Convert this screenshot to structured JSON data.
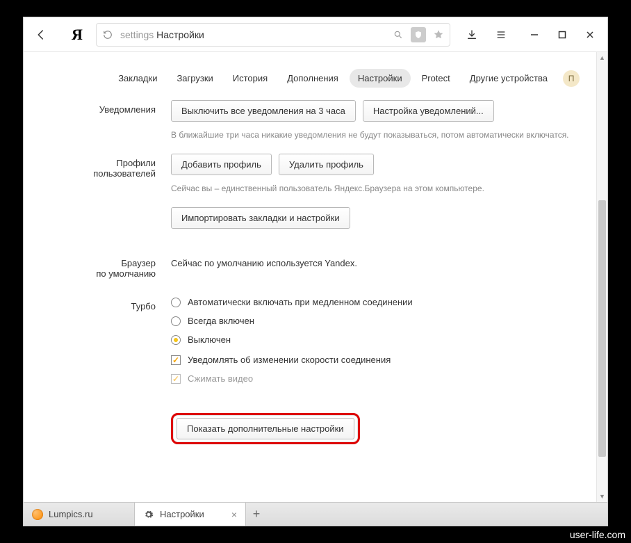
{
  "toolbar": {
    "address_prefix": "settings",
    "address_title": "Настройки"
  },
  "tabs": {
    "items": [
      "Закладки",
      "Загрузки",
      "История",
      "Дополнения",
      "Настройки",
      "Protect",
      "Другие устройства"
    ],
    "active_index": 4,
    "profile_initial": "П"
  },
  "notifications": {
    "label": "Уведомления",
    "btn_disable": "Выключить все уведомления на 3 часа",
    "btn_settings": "Настройка уведомлений...",
    "hint": "В ближайшие три часа никакие уведомления не будут показываться, потом автоматически включатся."
  },
  "profiles": {
    "label_line1": "Профили",
    "label_line2": "пользователей",
    "btn_add": "Добавить профиль",
    "btn_delete": "Удалить профиль",
    "hint": "Сейчас вы – единственный пользователь Яндекс.Браузера на этом компьютере.",
    "btn_import": "Импортировать закладки и настройки"
  },
  "default_browser": {
    "label_line1": "Браузер",
    "label_line2": "по умолчанию",
    "text": "Сейчас по умолчанию используется Yandex."
  },
  "turbo": {
    "label": "Турбо",
    "options": [
      "Автоматически включать при медленном соединении",
      "Всегда включен",
      "Выключен"
    ],
    "selected_index": 2,
    "check_notify": "Уведомлять об изменении скорости соединения",
    "check_notify_on": true,
    "check_compress": "Сжимать видео",
    "check_compress_on": true,
    "check_compress_disabled": true
  },
  "advanced": {
    "btn": "Показать дополнительные настройки"
  },
  "tabstrip": {
    "tabs": [
      {
        "title": "Lumpics.ru",
        "favicon": "orange",
        "active": false
      },
      {
        "title": "Настройки",
        "favicon": "gear",
        "active": true
      }
    ]
  },
  "watermark": "user-life.com"
}
